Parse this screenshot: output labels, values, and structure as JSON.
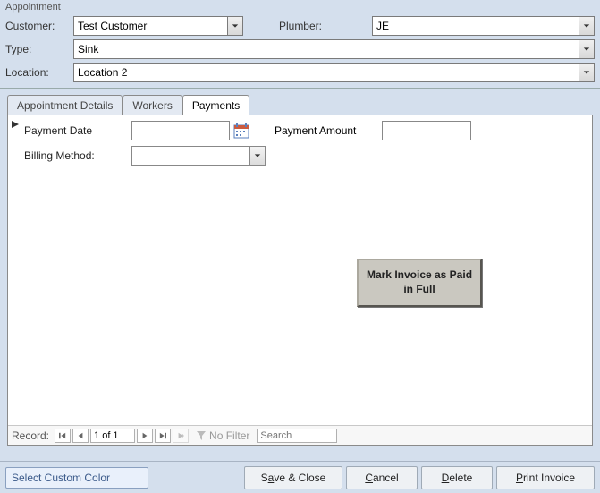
{
  "window_title": "Appointment",
  "header": {
    "customer_label": "Customer:",
    "customer_value": "Test Customer",
    "plumber_label": "Plumber:",
    "plumber_value": "JE",
    "type_label": "Type:",
    "type_value": "Sink",
    "location_label": "Location:",
    "location_value": "Location 2"
  },
  "tabs": {
    "details": "Appointment Details",
    "workers": "Workers",
    "payments": "Payments"
  },
  "payments": {
    "date_label": "Payment Date",
    "date_value": "",
    "amount_label": "Payment Amount",
    "amount_value": "",
    "billing_label": "Billing Method:",
    "billing_value": "",
    "mark_button": "Mark Invoice as Paid in Full"
  },
  "nav": {
    "record_label": "Record:",
    "record_pos": "1 of 1",
    "no_filter": "No Filter",
    "search_placeholder": "Search"
  },
  "buttons": {
    "custom_color": "Select Custom Color",
    "save_close_pre": "S",
    "save_close_ul": "a",
    "save_close_post": "ve & Close",
    "cancel_ul": "C",
    "cancel_post": "ancel",
    "delete_ul": "D",
    "delete_post": "elete",
    "print_ul": "P",
    "print_post": "rint Invoice"
  }
}
